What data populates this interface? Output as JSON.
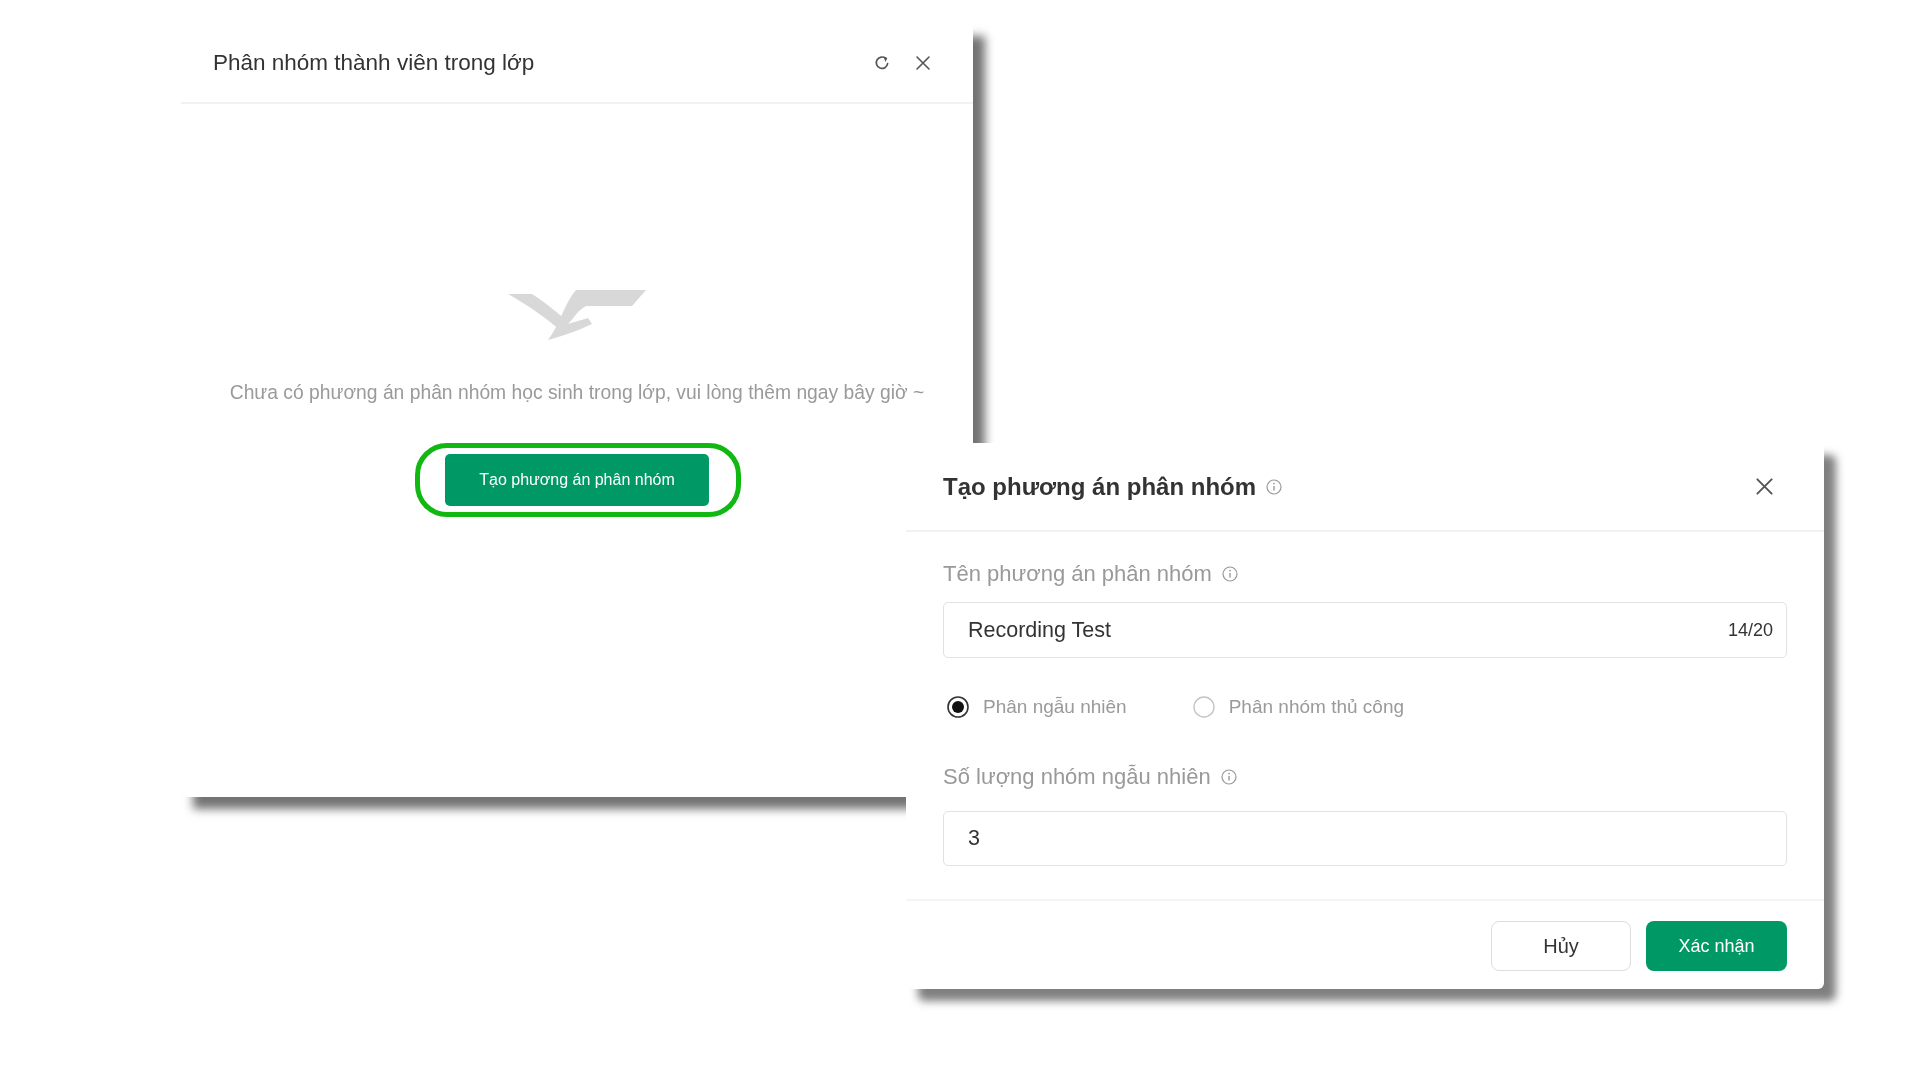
{
  "main_window": {
    "title": "Phân nhóm thành viên trong lớp",
    "empty_state": {
      "message": "Chưa có phương án phân nhóm học sinh trong lớp, vui lòng thêm ngay bây giờ ~"
    },
    "create_button": {
      "label": "Tạo phương án phân nhóm",
      "highlighted": true
    }
  },
  "create_dialog": {
    "title": "Tạo phương án phân nhóm",
    "name_field": {
      "label": "Tên phương án phân nhóm",
      "value": "Recording Test",
      "counter": "14/20"
    },
    "mode_options": [
      {
        "label": "Phân ngẫu nhiên",
        "selected": true
      },
      {
        "label": "Phân nhóm thủ công",
        "selected": false
      }
    ],
    "count_field": {
      "label": "Số lượng nhóm ngẫu nhiên",
      "value": "3"
    },
    "buttons": [
      {
        "label": "Hủy",
        "kind": "secondary"
      },
      {
        "label": "Xác nhận",
        "kind": "primary"
      }
    ]
  }
}
